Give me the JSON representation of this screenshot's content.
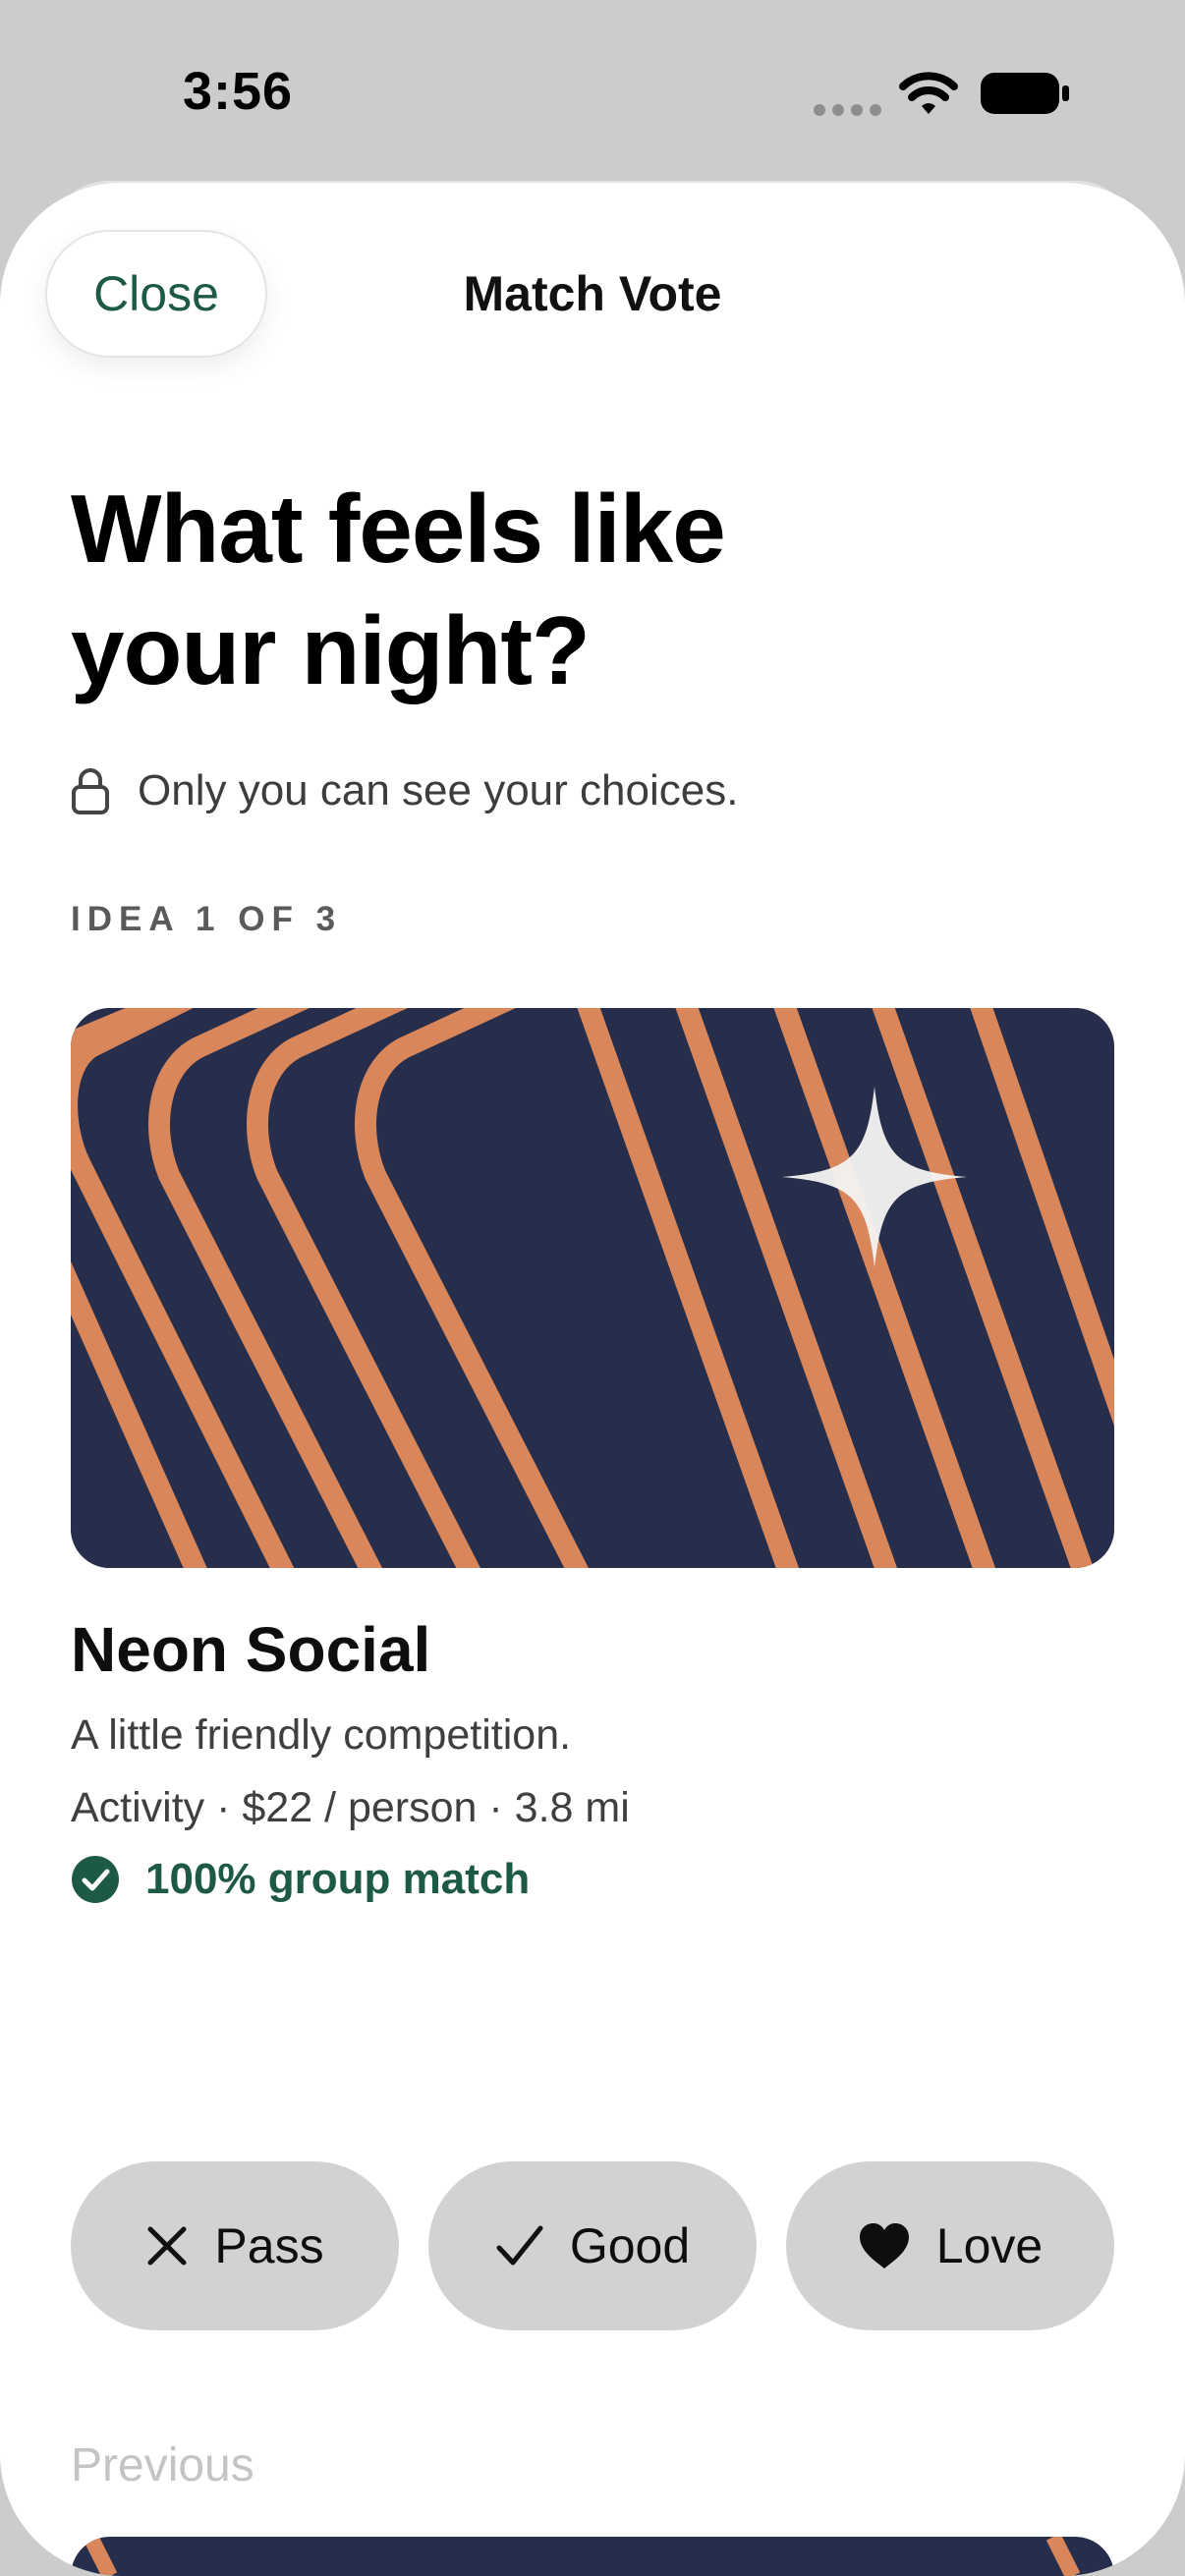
{
  "status_bar": {
    "time": "3:56"
  },
  "nav": {
    "close_label": "Close",
    "title": "Match Vote"
  },
  "header": {
    "headline": "What feels like your night?",
    "privacy_note": "Only you can see your choices.",
    "progress_label": "IDEA 1 OF 3"
  },
  "idea": {
    "title": "Neon Social",
    "tagline": "A little friendly competition.",
    "meta": "Activity · $22 / person · 3.8 mi",
    "match_label": "100% group match",
    "image": {
      "background_color": "#262e4c",
      "stripe_color": "#d9875a",
      "sparkle_color": "#f4f2f0"
    }
  },
  "vote_buttons": [
    {
      "id": "pass",
      "label": "Pass",
      "icon": "x-icon"
    },
    {
      "id": "good",
      "label": "Good",
      "icon": "checkmark-icon"
    },
    {
      "id": "love",
      "label": "Love",
      "icon": "heart-icon"
    }
  ],
  "footer": {
    "previous_label": "Previous"
  },
  "colors": {
    "accent_green": "#1d5a43",
    "button_gray": "#d2d2d2",
    "backdrop": "#cccccc"
  }
}
